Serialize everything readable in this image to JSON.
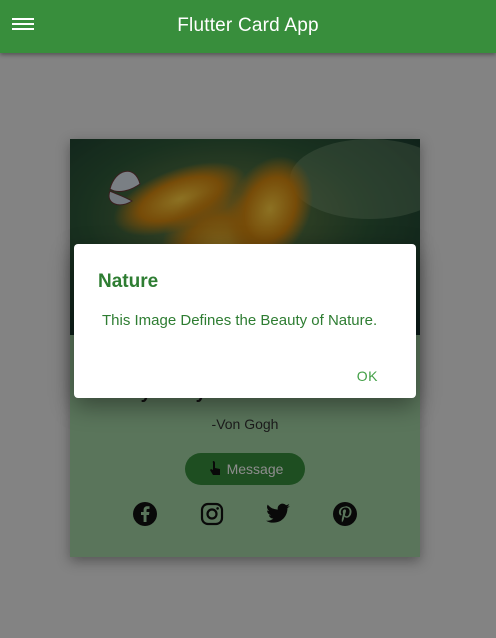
{
  "appbar": {
    "title": "Flutter Card App",
    "menu_icon": "menu-icon",
    "color": "#388e3c"
  },
  "card": {
    "image": "nature-butterfly-image",
    "quote_tail": "beauty everywhere.",
    "author": "-Von Gogh",
    "message_button": "Message",
    "background": "#a5d6a7",
    "social": [
      "facebook-icon",
      "instagram-icon",
      "twitter-icon",
      "pinterest-icon"
    ]
  },
  "dialog": {
    "title": "Nature",
    "body": "This Image Defines the Beauty of Nature.",
    "ok": "OK"
  }
}
